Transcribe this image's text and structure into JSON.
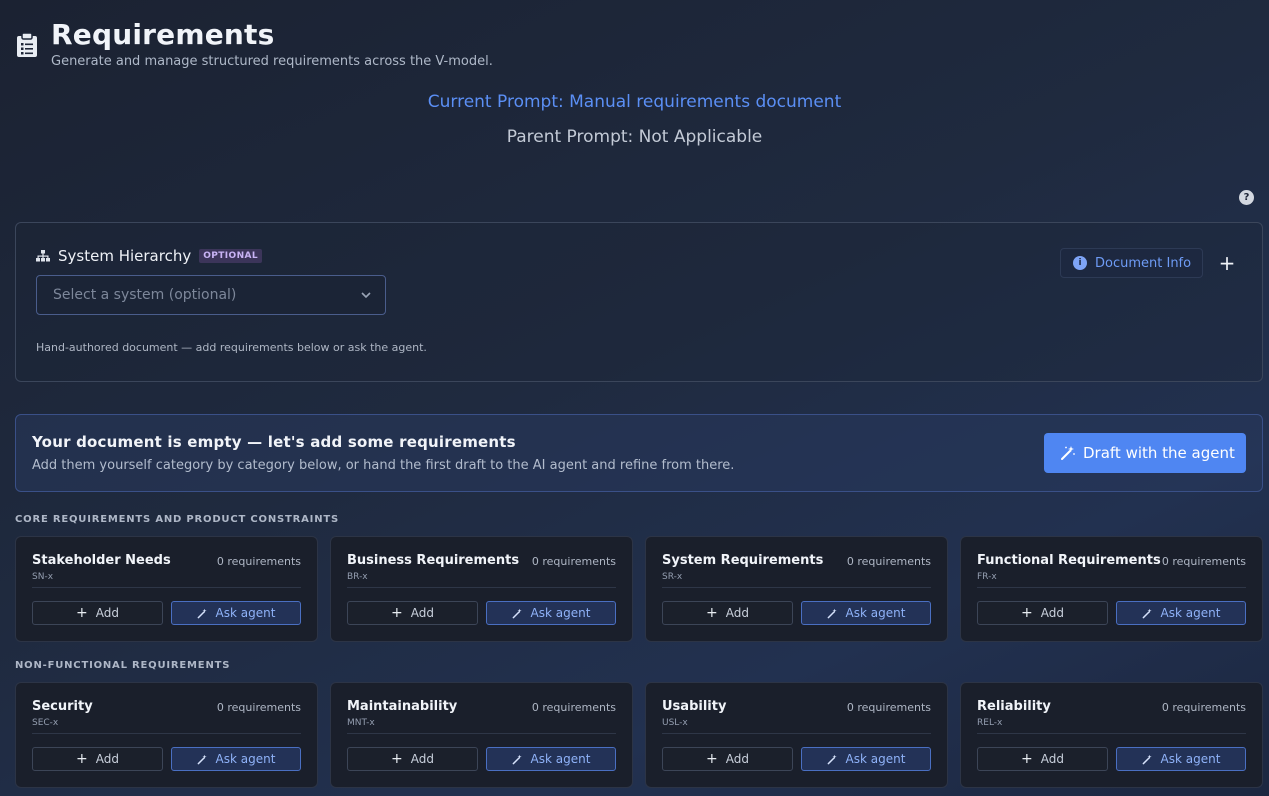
{
  "header": {
    "title": "Requirements",
    "subtitle": "Generate and manage structured requirements across the V-model.",
    "icon": "clipboard-icon"
  },
  "prompts": {
    "current": "Current Prompt: Manual requirements document",
    "parent": "Parent Prompt: Not Applicable"
  },
  "help": {
    "label": "?"
  },
  "hierarchy": {
    "title": "System Hierarchy",
    "badge": "OPTIONAL",
    "select_value": "Select a system (optional)",
    "note": "Hand-authored document — add requirements below or ask the agent.",
    "doc_info_label": "Document Info",
    "info_glyph": "i",
    "plus_glyph": "+"
  },
  "empty_state": {
    "title": "Your document is empty — let's add some requirements",
    "description": "Add them yourself category by category below, or hand the first draft to the AI agent and refine from there.",
    "draft_button": "Draft with the agent"
  },
  "buttons": {
    "add": "Add",
    "ask": "Ask agent",
    "plus_glyph": "+"
  },
  "sections": [
    {
      "label": "CORE REQUIREMENTS AND PRODUCT CONSTRAINTS",
      "cards": [
        {
          "title": "Stakeholder Needs",
          "prefix": "SN-x",
          "count": "0 requirements"
        },
        {
          "title": "Business Requirements",
          "prefix": "BR-x",
          "count": "0 requirements"
        },
        {
          "title": "System Requirements",
          "prefix": "SR-x",
          "count": "0 requirements"
        },
        {
          "title": "Functional Requirements",
          "prefix": "FR-x",
          "count": "0 requirements"
        }
      ]
    },
    {
      "label": "NON-FUNCTIONAL REQUIREMENTS",
      "cards": [
        {
          "title": "Security",
          "prefix": "SEC-x",
          "count": "0 requirements"
        },
        {
          "title": "Maintainability",
          "prefix": "MNT-x",
          "count": "0 requirements"
        },
        {
          "title": "Usability",
          "prefix": "USL-x",
          "count": "0 requirements"
        },
        {
          "title": "Reliability",
          "prefix": "REL-x",
          "count": "0 requirements"
        }
      ]
    }
  ],
  "colors": {
    "accent": "#4f86f2",
    "prompt_blue": "#5b8ff5",
    "badge_purple": "#c9b4f5"
  }
}
